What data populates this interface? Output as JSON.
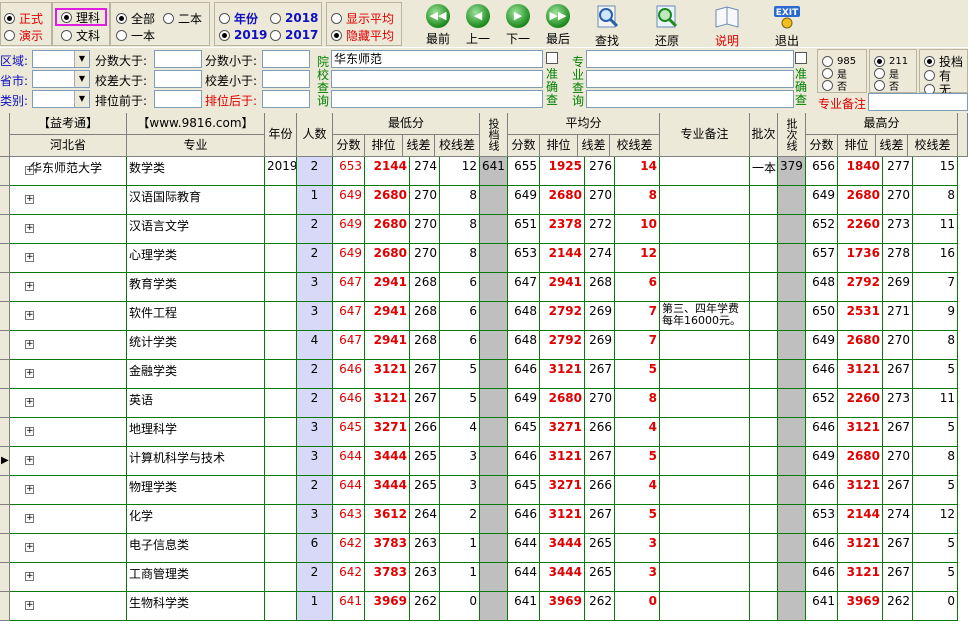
{
  "toolbar": {
    "mode_a": "正式",
    "mode_b": "演示",
    "subject_a": "理科",
    "subject_b": "文科",
    "batch_a": "全部",
    "batch_b": "二本",
    "batch_c": "一本",
    "year_label": "年份",
    "year_2018": "2018",
    "year_2019": "2019",
    "year_2017": "2017",
    "avg_show": "显示平均",
    "avg_hide": "隐藏平均",
    "nav": [
      {
        "label": "最前",
        "glyph": "◀◀"
      },
      {
        "label": "上一",
        "glyph": "◀"
      },
      {
        "label": "下一",
        "glyph": "▶"
      },
      {
        "label": "最后",
        "glyph": "▶▶"
      }
    ],
    "search": "查找",
    "restore": "还原",
    "help": "说明",
    "exit": "退出",
    "exit_icon_text": "EXIT"
  },
  "filters": {
    "region": "区域:",
    "city": "省市:",
    "category": "类别:",
    "score_gt": "分数大于:",
    "diff_gt": "校差大于:",
    "rank_before": "排位前于:",
    "score_lt": "分数小于:",
    "diff_lt": "校差小于:",
    "rank_after": "排位后于:",
    "school_query": "院校查询",
    "school_value": "华东师范",
    "exact": "准确查",
    "major_query": "专业查询",
    "exact2": "准确查",
    "opt985": "985",
    "opt_yes": "是",
    "opt_no": "否",
    "opt211": "211",
    "opt_yes2": "是",
    "opt_no2": "否",
    "invest": "投档",
    "has": "有",
    "none": "无",
    "major_note_label": "专业备注"
  },
  "grid": {
    "headers": {
      "brand": "【益考通】",
      "province": "河北省",
      "site": "【www.9816.com】",
      "major": "专业",
      "year": "年份",
      "count": "人数",
      "min": "最低分",
      "avg": "平均分",
      "max": "最高分",
      "score": "分数",
      "rank": "排位",
      "line_diff": "线差",
      "school_diff": "校线差",
      "invest_line": "投档线",
      "note": "专业备注",
      "batch": "批次",
      "batch_line": "批次线"
    },
    "school": "华东师范大学",
    "year": "2019",
    "invest_line": "641",
    "batch": "一本",
    "batch_line": "379",
    "rows": [
      {
        "major": "数学类",
        "n": "2",
        "mn": "653",
        "mr": "2144",
        "ml": "274",
        "ms": "12",
        "an": "655",
        "ar": "1925",
        "al": "276",
        "as": "14",
        "note": "",
        "xn": "656",
        "xr": "1840",
        "xl": "277",
        "xs": "15"
      },
      {
        "major": "汉语国际教育",
        "n": "1",
        "mn": "649",
        "mr": "2680",
        "ml": "270",
        "ms": "8",
        "an": "649",
        "ar": "2680",
        "al": "270",
        "as": "8",
        "note": "",
        "xn": "649",
        "xr": "2680",
        "xl": "270",
        "xs": "8"
      },
      {
        "major": "汉语言文学",
        "n": "2",
        "mn": "649",
        "mr": "2680",
        "ml": "270",
        "ms": "8",
        "an": "651",
        "ar": "2378",
        "al": "272",
        "as": "10",
        "note": "",
        "xn": "652",
        "xr": "2260",
        "xl": "273",
        "xs": "11"
      },
      {
        "major": "心理学类",
        "n": "2",
        "mn": "649",
        "mr": "2680",
        "ml": "270",
        "ms": "8",
        "an": "653",
        "ar": "2144",
        "al": "274",
        "as": "12",
        "note": "",
        "xn": "657",
        "xr": "1736",
        "xl": "278",
        "xs": "16"
      },
      {
        "major": "教育学类",
        "n": "3",
        "mn": "647",
        "mr": "2941",
        "ml": "268",
        "ms": "6",
        "an": "647",
        "ar": "2941",
        "al": "268",
        "as": "6",
        "note": "",
        "xn": "648",
        "xr": "2792",
        "xl": "269",
        "xs": "7"
      },
      {
        "major": "软件工程",
        "n": "3",
        "mn": "647",
        "mr": "2941",
        "ml": "268",
        "ms": "6",
        "an": "648",
        "ar": "2792",
        "al": "269",
        "as": "7",
        "note": "第三、四年学费每年16000元。",
        "xn": "650",
        "xr": "2531",
        "xl": "271",
        "xs": "9"
      },
      {
        "major": "统计学类",
        "n": "4",
        "mn": "647",
        "mr": "2941",
        "ml": "268",
        "ms": "6",
        "an": "648",
        "ar": "2792",
        "al": "269",
        "as": "7",
        "note": "",
        "xn": "649",
        "xr": "2680",
        "xl": "270",
        "xs": "8"
      },
      {
        "major": "金融学类",
        "n": "2",
        "mn": "646",
        "mr": "3121",
        "ml": "267",
        "ms": "5",
        "an": "646",
        "ar": "3121",
        "al": "267",
        "as": "5",
        "note": "",
        "xn": "646",
        "xr": "3121",
        "xl": "267",
        "xs": "5"
      },
      {
        "major": "英语",
        "n": "2",
        "mn": "646",
        "mr": "3121",
        "ml": "267",
        "ms": "5",
        "an": "649",
        "ar": "2680",
        "al": "270",
        "as": "8",
        "note": "",
        "xn": "652",
        "xr": "2260",
        "xl": "273",
        "xs": "11"
      },
      {
        "major": "地理科学",
        "n": "3",
        "mn": "645",
        "mr": "3271",
        "ml": "266",
        "ms": "4",
        "an": "645",
        "ar": "3271",
        "al": "266",
        "as": "4",
        "note": "",
        "xn": "646",
        "xr": "3121",
        "xl": "267",
        "xs": "5"
      },
      {
        "major": "计算机科学与技术",
        "n": "3",
        "mn": "644",
        "mr": "3444",
        "ml": "265",
        "ms": "3",
        "an": "646",
        "ar": "3121",
        "al": "267",
        "as": "5",
        "note": "",
        "xn": "649",
        "xr": "2680",
        "xl": "270",
        "xs": "8"
      },
      {
        "major": "物理学类",
        "n": "2",
        "mn": "644",
        "mr": "3444",
        "ml": "265",
        "ms": "3",
        "an": "645",
        "ar": "3271",
        "al": "266",
        "as": "4",
        "note": "",
        "xn": "646",
        "xr": "3121",
        "xl": "267",
        "xs": "5"
      },
      {
        "major": "化学",
        "n": "3",
        "mn": "643",
        "mr": "3612",
        "ml": "264",
        "ms": "2",
        "an": "646",
        "ar": "3121",
        "al": "267",
        "as": "5",
        "note": "",
        "xn": "653",
        "xr": "2144",
        "xl": "274",
        "xs": "12"
      },
      {
        "major": "电子信息类",
        "n": "6",
        "mn": "642",
        "mr": "3783",
        "ml": "263",
        "ms": "1",
        "an": "644",
        "ar": "3444",
        "al": "265",
        "as": "3",
        "note": "",
        "xn": "646",
        "xr": "3121",
        "xl": "267",
        "xs": "5"
      },
      {
        "major": "工商管理类",
        "n": "2",
        "mn": "642",
        "mr": "3783",
        "ml": "263",
        "ms": "1",
        "an": "644",
        "ar": "3444",
        "al": "265",
        "as": "3",
        "note": "",
        "xn": "646",
        "xr": "3121",
        "xl": "267",
        "xs": "5"
      },
      {
        "major": "生物科学类",
        "n": "1",
        "mn": "641",
        "mr": "3969",
        "ml": "262",
        "ms": "0",
        "an": "641",
        "ar": "3969",
        "al": "262",
        "as": "0",
        "note": "",
        "xn": "641",
        "xr": "3969",
        "xl": "262",
        "xs": "0"
      }
    ]
  }
}
